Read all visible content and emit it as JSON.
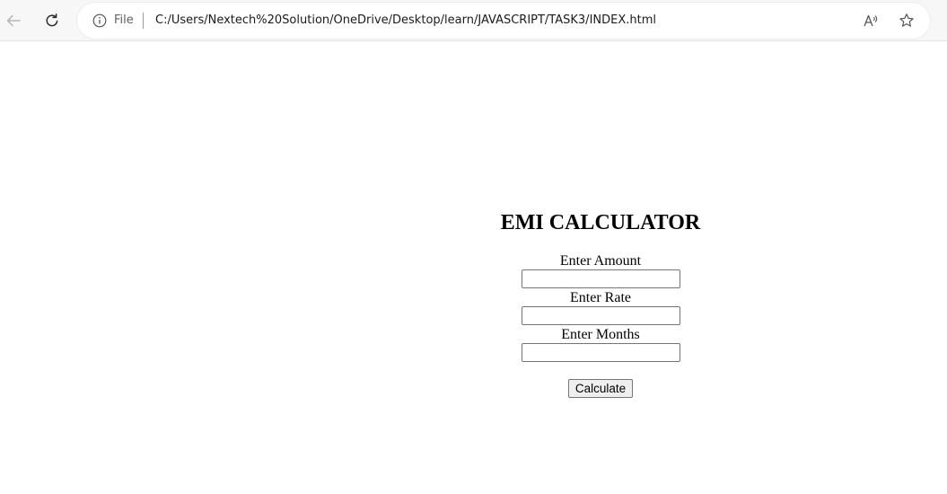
{
  "browser": {
    "scheme_label": "File",
    "url": "C:/Users/Nextech%20Solution/OneDrive/Desktop/learn/JAVASCRIPT/TASK3/INDEX.html",
    "icons": {
      "back": "back-arrow-icon",
      "reload": "reload-icon",
      "info": "info-icon",
      "read_aloud": "read-aloud-icon",
      "favorite": "star-icon"
    }
  },
  "page": {
    "title": "EMI CALCULATOR",
    "fields": [
      {
        "label": "Enter Amount",
        "value": ""
      },
      {
        "label": "Enter Rate",
        "value": ""
      },
      {
        "label": "Enter Months",
        "value": ""
      }
    ],
    "button_label": "Calculate"
  }
}
